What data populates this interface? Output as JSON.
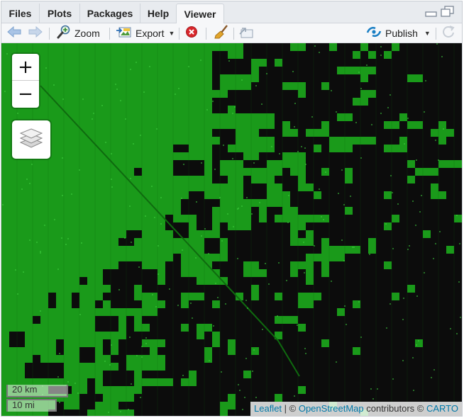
{
  "tabs": [
    {
      "label": "Files",
      "active": false
    },
    {
      "label": "Plots",
      "active": false
    },
    {
      "label": "Packages",
      "active": false
    },
    {
      "label": "Help",
      "active": false
    },
    {
      "label": "Viewer",
      "active": true
    }
  ],
  "toolbar": {
    "back_icon": "arrow-left-icon",
    "forward_icon": "arrow-right-icon",
    "zoom_label": "Zoom",
    "export_label": "Export",
    "publish_label": "Publish"
  },
  "map": {
    "zoom_in_label": "+",
    "zoom_out_label": "−",
    "scale_km": "20 km",
    "scale_mi": "10 mi",
    "attribution": {
      "leaflet": "Leaflet",
      "separator": " | © ",
      "osm": "OpenStreetMap",
      "contributors": " contributors © ",
      "carto": "CARTO"
    },
    "colors": {
      "vegetation": "#1a9a1a",
      "bare": "#0c0c0c",
      "accent": "#1a7fc4"
    }
  }
}
